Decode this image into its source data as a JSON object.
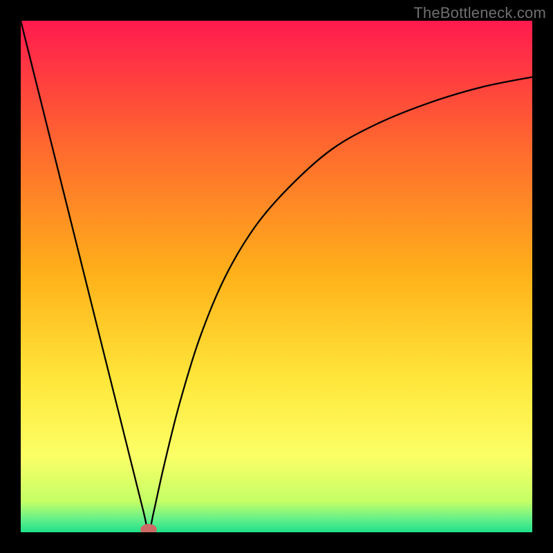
{
  "watermark": "TheBottleneck.com",
  "chart_data": {
    "type": "line",
    "title": "",
    "xlabel": "",
    "ylabel": "",
    "xlim": [
      0,
      100
    ],
    "ylim": [
      0,
      100
    ],
    "grid": false,
    "legend": false,
    "background_gradient": {
      "stops": [
        {
          "offset": 0.0,
          "color": "#ff1a4e"
        },
        {
          "offset": 0.25,
          "color": "#ff6a2e"
        },
        {
          "offset": 0.5,
          "color": "#ffb21a"
        },
        {
          "offset": 0.7,
          "color": "#ffe63a"
        },
        {
          "offset": 0.85,
          "color": "#fcff66"
        },
        {
          "offset": 0.94,
          "color": "#c4ff66"
        },
        {
          "offset": 0.975,
          "color": "#63ef8a"
        },
        {
          "offset": 1.0,
          "color": "#1fe08a"
        }
      ]
    },
    "series": [
      {
        "name": "bottleneck-curve",
        "points": [
          {
            "x": 0,
            "y": 100
          },
          {
            "x": 5,
            "y": 80
          },
          {
            "x": 10,
            "y": 60
          },
          {
            "x": 15,
            "y": 40
          },
          {
            "x": 20,
            "y": 20
          },
          {
            "x": 24,
            "y": 4
          },
          {
            "x": 25,
            "y": 0
          },
          {
            "x": 26,
            "y": 4
          },
          {
            "x": 28,
            "y": 13
          },
          {
            "x": 31,
            "y": 25
          },
          {
            "x": 35,
            "y": 38
          },
          {
            "x": 40,
            "y": 50
          },
          {
            "x": 46,
            "y": 60
          },
          {
            "x": 53,
            "y": 68
          },
          {
            "x": 61,
            "y": 75
          },
          {
            "x": 70,
            "y": 80
          },
          {
            "x": 80,
            "y": 84
          },
          {
            "x": 90,
            "y": 87
          },
          {
            "x": 100,
            "y": 89
          }
        ]
      }
    ],
    "marker": {
      "name": "bottleneck-point",
      "x": 25,
      "y": 0,
      "rx": 1.6,
      "ry": 1.1,
      "color": "#cc6b66"
    }
  }
}
